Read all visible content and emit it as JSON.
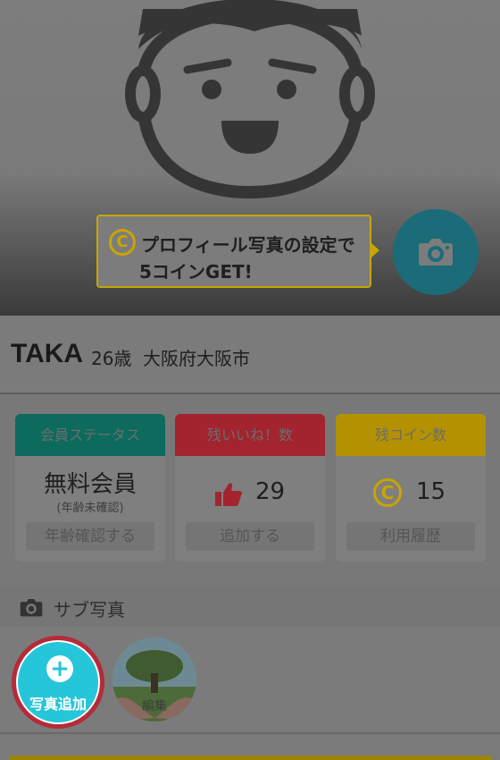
{
  "hero": {
    "tooltip_line1": "プロフィール写真の設定で",
    "tooltip_line2": "5コインGET!",
    "coin_glyph": "C"
  },
  "profile": {
    "name": "TAKA",
    "age": "26歳",
    "location": "大阪府大阪市"
  },
  "cards": [
    {
      "header": "会員ステータス",
      "header_color": "#0d6b5e",
      "value": "無料会員",
      "sub": "(年齢未確認)",
      "button": "年齢確認する"
    },
    {
      "header": "残いいね！数",
      "header_color": "#a3232f",
      "value": "29",
      "button": "追加する"
    },
    {
      "header": "残コイン数",
      "header_color": "#b39100",
      "value": "15",
      "button": "利用履歴"
    }
  ],
  "sub_photos": {
    "title": "サブ写真",
    "add_label": "写真追加",
    "edit_label": "編集"
  },
  "colors": {
    "accent_teal": "#26c6da",
    "highlight_red": "#b52b3a",
    "coin_gold": "#c9a500"
  }
}
